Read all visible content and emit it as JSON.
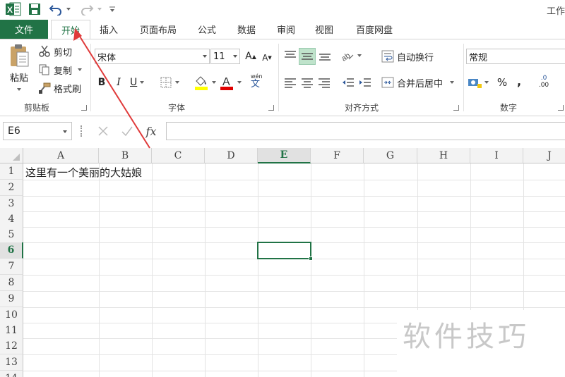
{
  "window": {
    "title": "工作"
  },
  "tabs": {
    "file": "文件",
    "home": "开始",
    "insert": "插入",
    "page_layout": "页面布局",
    "formulas": "公式",
    "data": "数据",
    "review": "审阅",
    "view": "视图",
    "baidu_netdisk": "百度网盘"
  },
  "clipboard": {
    "paste": "粘贴",
    "cut": "剪切",
    "copy": "复制",
    "format_painter": "格式刷",
    "group": "剪贴板"
  },
  "font": {
    "name": "宋体",
    "size": "11",
    "group": "字体",
    "phonetic": "wén",
    "phonetic_char": "文",
    "bold": "B",
    "italic": "I",
    "underline": "U",
    "grow": "A",
    "shrink": "A"
  },
  "alignment": {
    "wrap_text": "自动换行",
    "merge_center": "合并后居中",
    "group": "对齐方式"
  },
  "number": {
    "format": "常规",
    "percent": "%",
    "comma": ",",
    "dec_inc_top": ".0",
    "dec_inc_bottom": ".00",
    "group": "数字"
  },
  "formula_bar": {
    "name_box": "E6",
    "fx": "fx",
    "value": ""
  },
  "grid": {
    "columns": [
      "A",
      "B",
      "C",
      "D",
      "E",
      "F",
      "G",
      "H",
      "I",
      "J"
    ],
    "rows": [
      "1",
      "2",
      "3",
      "4",
      "5",
      "6",
      "7",
      "8",
      "9",
      "10",
      "11",
      "12",
      "13",
      "14"
    ],
    "selected_column": "E",
    "selected_row": "6",
    "cells": {
      "A1": "这里有一个美丽的大姑娘"
    }
  },
  "watermark": "软件技巧",
  "colors": {
    "accent": "#217346",
    "arrow": "#e03a3a"
  }
}
